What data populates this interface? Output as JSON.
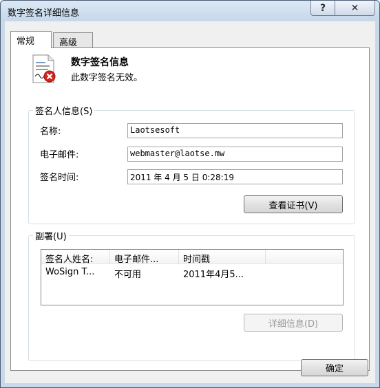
{
  "window": {
    "title": "数字签名详细信息",
    "help_glyph": "?",
    "close_glyph": "✕"
  },
  "tabs": [
    {
      "label": "常规",
      "active": true
    },
    {
      "label": "高级",
      "active": false
    }
  ],
  "signature_info": {
    "heading": "数字签名信息",
    "status": "此数字签名无效。",
    "icon": "certificate-invalid-icon"
  },
  "signer": {
    "group_title": "签名人信息(S)",
    "name_label": "名称:",
    "name_value": "Laotsesoft",
    "email_label": "电子邮件:",
    "email_value": "webmaster@laotse.mw",
    "time_label": "签名时间:",
    "time_value": " 2011  年  4  月  5  日 0:28:19",
    "view_cert_button": "查看证书(V)"
  },
  "countersign": {
    "group_title": "副署(U)",
    "columns": [
      "签名人姓名:",
      "电子邮件...",
      "时间戳"
    ],
    "rows": [
      {
        "name": "WoSign T...",
        "email": "不可用",
        "timestamp": "2011年4月5..."
      }
    ],
    "details_button": "详细信息(D)"
  },
  "footer": {
    "ok_button": "确定"
  },
  "colors": {
    "title_bar": "#c9d9ea",
    "dialog_face": "#f0f0f0",
    "invalid_mark": "#d9241c"
  }
}
